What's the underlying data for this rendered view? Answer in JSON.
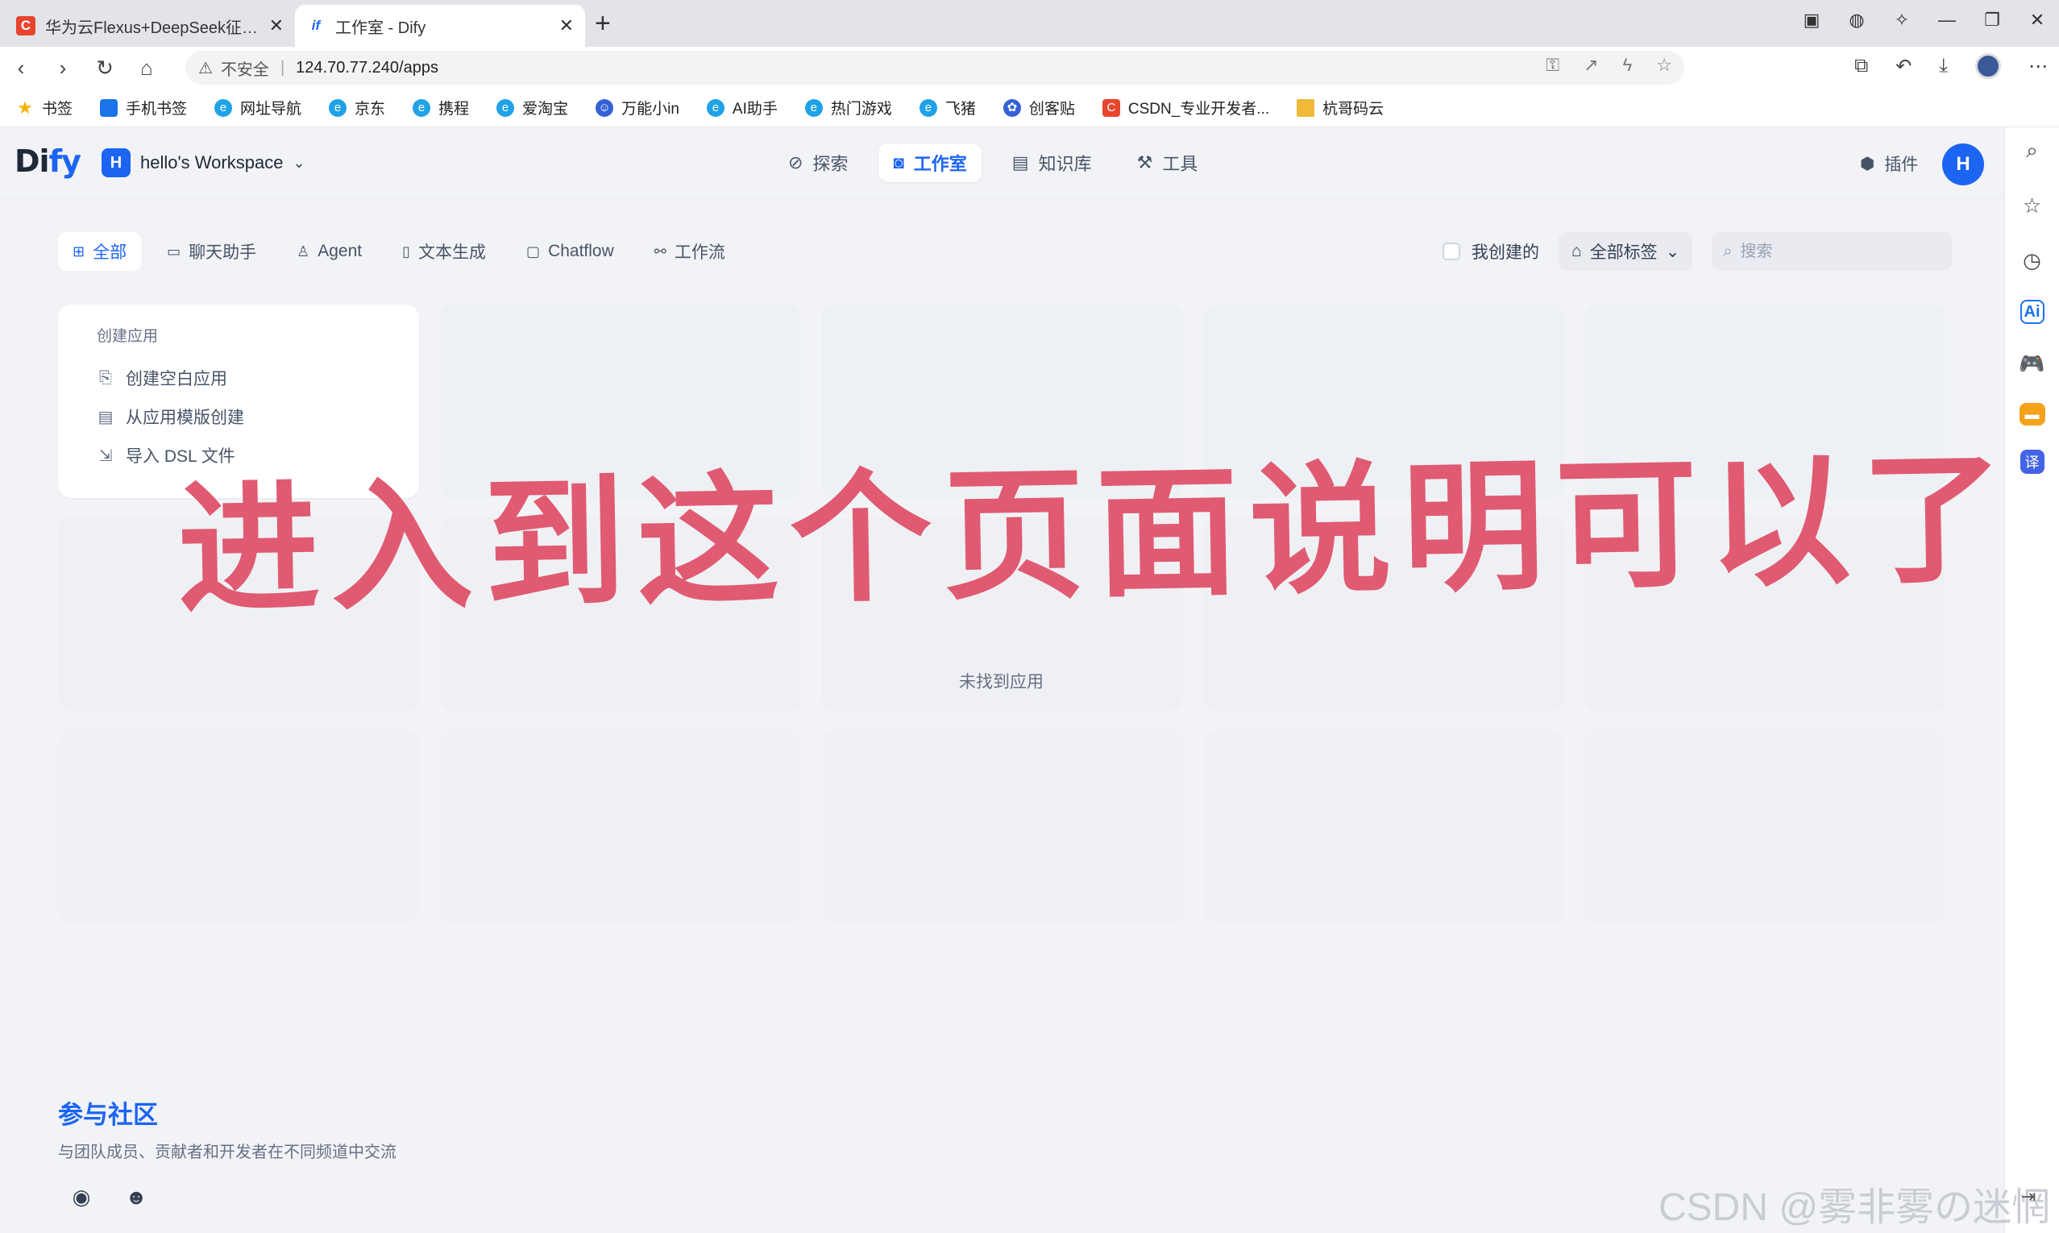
{
  "browser": {
    "tabs": [
      {
        "title": "华为云Flexus+DeepSeek征文 | 2",
        "favicon": "C"
      },
      {
        "title": "工作室 - Dify",
        "favicon": "if"
      }
    ],
    "new_tab": "+",
    "url_warning": "不安全",
    "url": "124.70.77.240/apps",
    "bookmarks": [
      "书签",
      "手机书签",
      "网址导航",
      "京东",
      "携程",
      "爱淘宝",
      "万能小in",
      "AI助手",
      "热门游戏",
      "飞猪",
      "创客贴",
      "CSDN_专业开发者...",
      "杭哥码云"
    ]
  },
  "app": {
    "logo_a": "Di",
    "logo_b": "fy",
    "workspace": {
      "avatar": "H",
      "name": "hello's Workspace"
    },
    "nav": [
      {
        "label": "探索",
        "icon": "compass-icon"
      },
      {
        "label": "工作室",
        "icon": "robot-icon",
        "active": true
      },
      {
        "label": "知识库",
        "icon": "book-icon"
      },
      {
        "label": "工具",
        "icon": "hammer-icon"
      }
    ],
    "plugins_label": "插件",
    "user_avatar": "H",
    "filters": [
      {
        "label": "全部",
        "active": true
      },
      {
        "label": "聊天助手"
      },
      {
        "label": "Agent"
      },
      {
        "label": "文本生成"
      },
      {
        "label": "Chatflow"
      },
      {
        "label": "工作流"
      }
    ],
    "mine_label": "我创建的",
    "tags_label": "全部标签",
    "search_placeholder": "搜索",
    "create": {
      "title": "创建应用",
      "items": [
        "创建空白应用",
        "从应用模版创建",
        "导入 DSL 文件"
      ]
    },
    "empty_text": "未找到应用",
    "community": {
      "title": "参与社区",
      "desc": "与团队成员、贡献者和开发者在不同频道中交流"
    }
  },
  "overlay": "进入到这个页面说明可以了",
  "watermark": "CSDN @雾非雾の迷惘",
  "colors": {
    "accent": "#1c64f2",
    "overlay": "#e05a72"
  }
}
